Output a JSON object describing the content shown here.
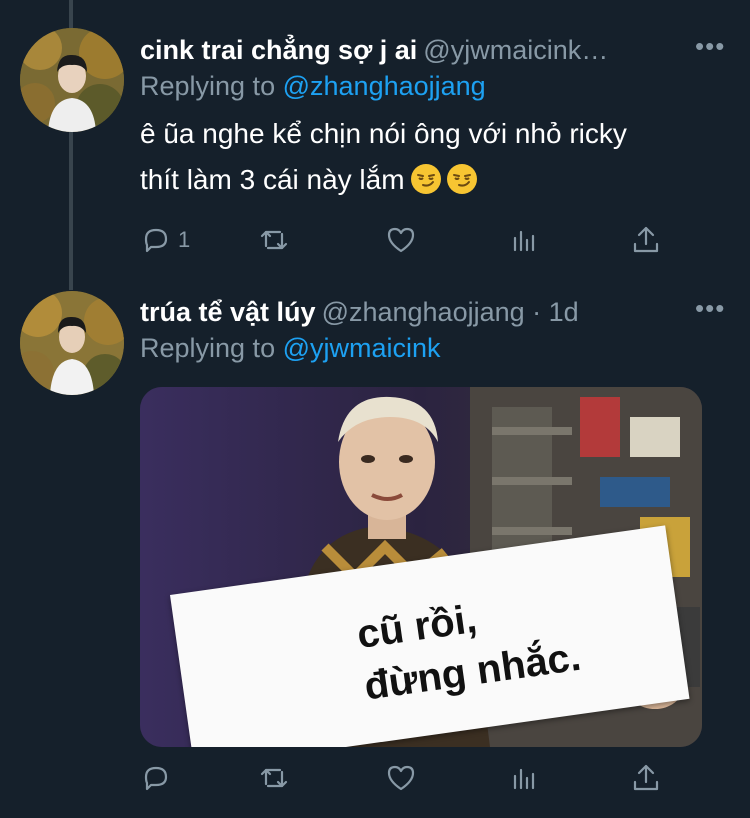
{
  "tweets": [
    {
      "display_name": "cink trai chẳng sợ j ai",
      "handle": "@yjwmaicink…",
      "replying_prefix": "Replying to",
      "replying_to": "@zhanghaojjang",
      "text_line1": "ê ũa nghe kể chịn nói ông với nhỏ ricky",
      "text_line2": "thít làm 3 cái này lắm",
      "emojis": [
        "smirking-face",
        "smirking-face"
      ],
      "reply_count": "1"
    },
    {
      "display_name": "trúa tể vật lúy",
      "handle": "@zhanghaojjang · 1d",
      "replying_prefix": "Replying to",
      "replying_to": "@yjwmaicink",
      "media_sign_line1": "cũ rồi,",
      "media_sign_line2": "đừng nhắc."
    }
  ],
  "more_label": "•••",
  "colors": {
    "background": "#15202b",
    "secondary_text": "#8899a6",
    "link": "#1da1f2",
    "thread_line": "#38444d"
  },
  "icons": [
    "reply-icon",
    "retweet-icon",
    "like-icon",
    "analytics-icon",
    "share-icon"
  ]
}
